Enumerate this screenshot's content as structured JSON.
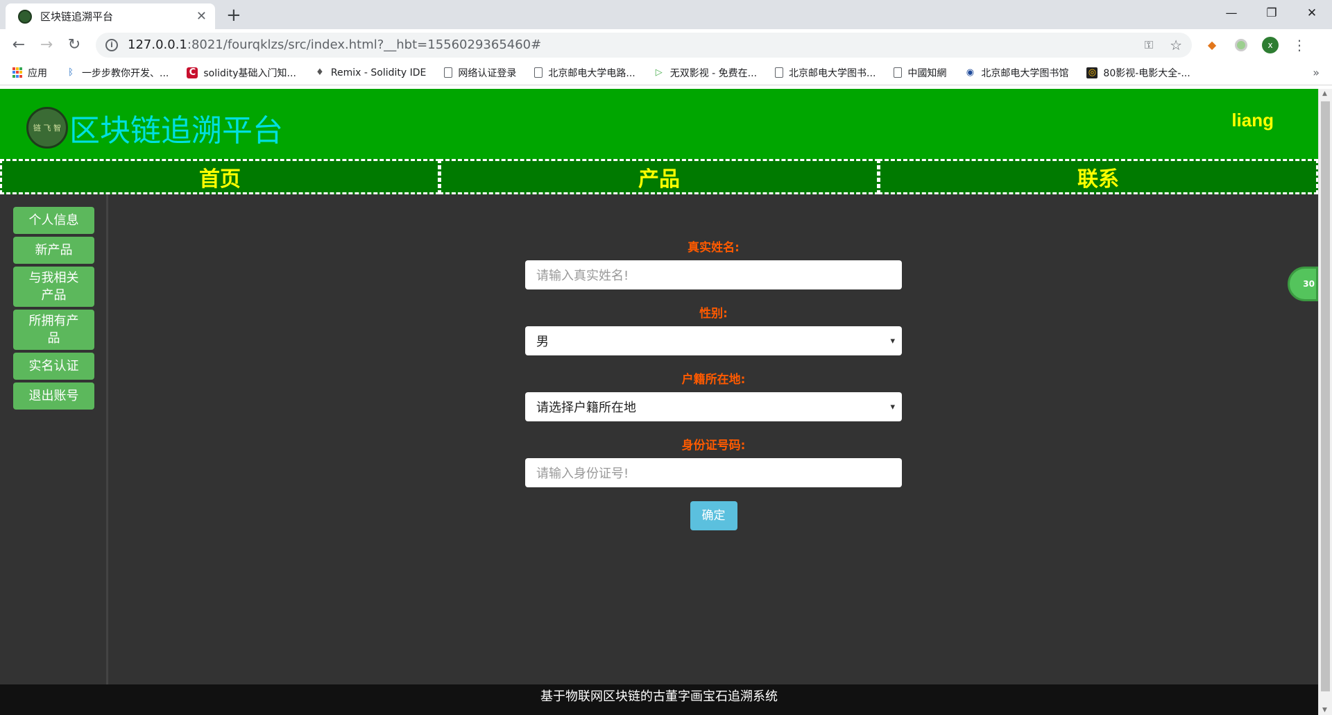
{
  "browser": {
    "tab_title": "区块链追溯平台",
    "tab_close": "✕",
    "new_tab": "+",
    "window_controls": [
      "—",
      "❐",
      "✕"
    ],
    "url_host": "127.0.0.1",
    "url_rest": ":8021/fourqklzs/src/index.html?__hbt=1556029365460#",
    "avatar_letter": "x",
    "bookmarks": [
      {
        "label": "应用",
        "icon": "apps-icon"
      },
      {
        "label": "一步步教你开发、...",
        "icon": "bluetooth-icon"
      },
      {
        "label": "solidity基础入门知...",
        "icon": "csdn-icon"
      },
      {
        "label": "Remix - Solidity IDE",
        "icon": "ethereum-icon"
      },
      {
        "label": "网络认证登录",
        "icon": "page-icon"
      },
      {
        "label": "北京邮电大学电路...",
        "icon": "page-icon"
      },
      {
        "label": "无双影视 - 免费在...",
        "icon": "play-icon"
      },
      {
        "label": "北京邮电大学图书...",
        "icon": "page-icon"
      },
      {
        "label": "中國知網",
        "icon": "page-icon"
      },
      {
        "label": "北京邮电大学图书馆",
        "icon": "globe-icon"
      },
      {
        "label": "80影视-电影大全-...",
        "icon": "film-icon"
      }
    ],
    "bookmarks_more": "»"
  },
  "site": {
    "logo_text": "链 飞 智",
    "title": "区块链追溯平台",
    "username": "liang",
    "nav": [
      "首页",
      "产品",
      "联系"
    ],
    "sidebar": [
      "个人信息",
      "新产品",
      "与我相关产品",
      "所拥有产品",
      "实名认证",
      "退出账号"
    ],
    "form": {
      "name_label": "真实姓名:",
      "name_placeholder": "请输入真实姓名!",
      "gender_label": "性别:",
      "gender_value": "男",
      "hukou_label": "户籍所在地:",
      "hukou_value": "请选择户籍所在地",
      "id_label": "身份证号码:",
      "id_placeholder": "请输入身份证号!",
      "submit": "确定"
    },
    "footer": "基于物联网区块链的古董字画宝石追溯系统",
    "float_badge": "30"
  }
}
